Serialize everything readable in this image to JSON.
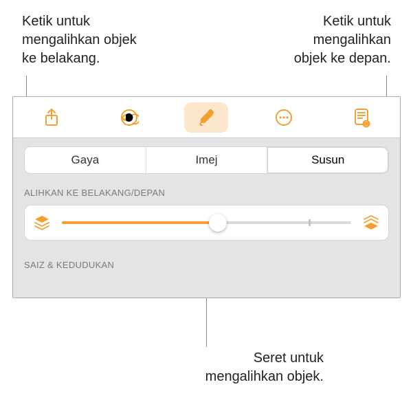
{
  "callouts": {
    "back_tap": "Ketik untuk\nmengalihkan objek\nke belakang.",
    "front_tap": "Ketik untuk\nmengalihkan\nobjek ke depan.",
    "drag": "Seret untuk\nmengalihkan objek."
  },
  "tabs": {
    "style": "Gaya",
    "image": "Imej",
    "arrange": "Susun"
  },
  "sections": {
    "move_label": "ALIHKAN KE BELAKANG/DEPAN",
    "size_label": "SAIZ & KEDUDUKAN"
  },
  "toolbar": {
    "share": "share",
    "undo": "undo",
    "format": "format",
    "more": "more",
    "reader": "reader"
  }
}
